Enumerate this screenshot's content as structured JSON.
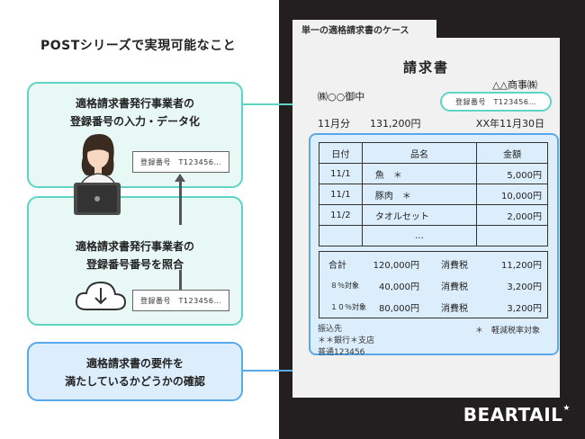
{
  "heading": "POSTシリーズで実現可能なこと",
  "steps": [
    {
      "line1": "適格請求書発行事業者の",
      "line2": "登録番号の入力・データ化"
    },
    {
      "line1": "適格請求書発行事業者の",
      "line2": "登録番号番号を照合"
    },
    {
      "line1": "適格請求書の要件を",
      "line2": "満たしているかどうかの確認"
    }
  ],
  "registration_box": "登録番号　T123456…",
  "icons": {
    "person": "office-worker-laptop-icon",
    "cloud": "cloud-download-icon",
    "arrow": "arrow-up-icon"
  },
  "document": {
    "tab": "単一の適格請求書のケース",
    "title": "請求書",
    "issuer": "△△商事㈱",
    "recipient": "㈱○○御中",
    "registration": "登録番号　T123456…",
    "month": "11月分",
    "amount": "131,200円",
    "date": "XX年11月30日",
    "headers": [
      "日付",
      "品名",
      "金額"
    ],
    "rows": [
      {
        "date": "11/1",
        "name": "魚　＊",
        "price": "5,000円"
      },
      {
        "date": "11/1",
        "name": "豚肉　＊",
        "price": "10,000円"
      },
      {
        "date": "11/2",
        "name": "タオルセット",
        "price": "2,000円"
      },
      {
        "date": "",
        "name": "…",
        "price": ""
      }
    ],
    "totals": [
      {
        "label": "合計",
        "value": "120,000円",
        "tax_label": "消費税",
        "tax": "11,200円"
      },
      {
        "label": "８％対象",
        "value": "40,000円",
        "tax_label": "消費税",
        "tax": "3,200円"
      },
      {
        "label": "１０％対象",
        "value": "80,000円",
        "tax_label": "消費税",
        "tax": "3,200円"
      }
    ],
    "bank_title": "振込先",
    "bank_branch": "＊＊銀行＊支店",
    "bank_account": "普通123456",
    "reduced_note": "＊　軽減税率対象"
  },
  "brand": "BEARTAIL",
  "colors": {
    "teal": "#5fd3c4",
    "blue": "#5aa8ec",
    "dark": "#231f20"
  }
}
